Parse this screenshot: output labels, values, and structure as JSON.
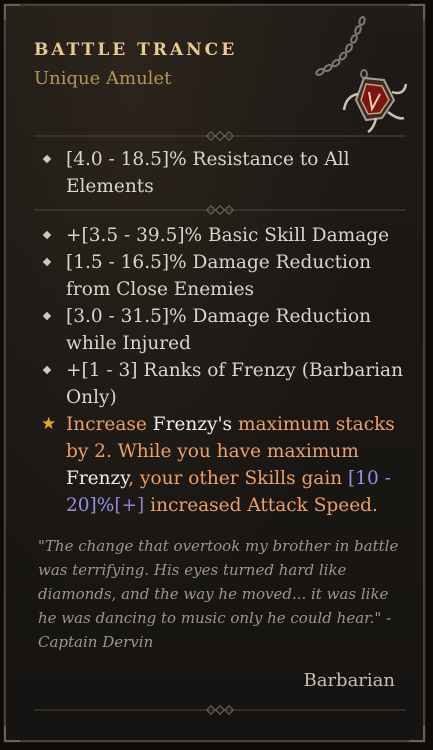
{
  "item": {
    "name": "BATTLE TRANCE",
    "type": "Unique Amulet",
    "icon": "amulet-icon",
    "implicit_affixes": [
      "[4.0 - 18.5]% Resistance to All Elements"
    ],
    "affixes": [
      "+[3.5 - 39.5]% Basic Skill Damage",
      "[1.5 - 16.5]% Damage Reduction from Close Enemies",
      "[3.0 - 31.5]% Damage Reduction while Injured",
      "+[1 - 3] Ranks of Frenzy (Barbarian Only)"
    ],
    "legendary_power": {
      "t1": "Increase ",
      "t2": "Frenzy's",
      "t3": " maximum stacks by 2.  While you have maximum ",
      "t4": "Frenzy",
      "t5": ", your other Skills gain ",
      "t6": "[10 - 20]%",
      "t7": "[+]",
      "t8": " increased Attack Speed."
    },
    "flavor_text": "\"The change that overtook my brother in battle was terrifying. His eyes turned hard like diamonds, and the way he moved... it was like he was dancing to music only he could hear.\" - Captain Dervin",
    "class_requirement": "Barbarian"
  },
  "colors": {
    "title": "#e8c98f",
    "item_type": "#b59458",
    "affix": "#d9d5cc",
    "legendary": "#eda064",
    "range": "#9a8fe6",
    "flavor": "#9e9589",
    "star": "#e8a524"
  }
}
